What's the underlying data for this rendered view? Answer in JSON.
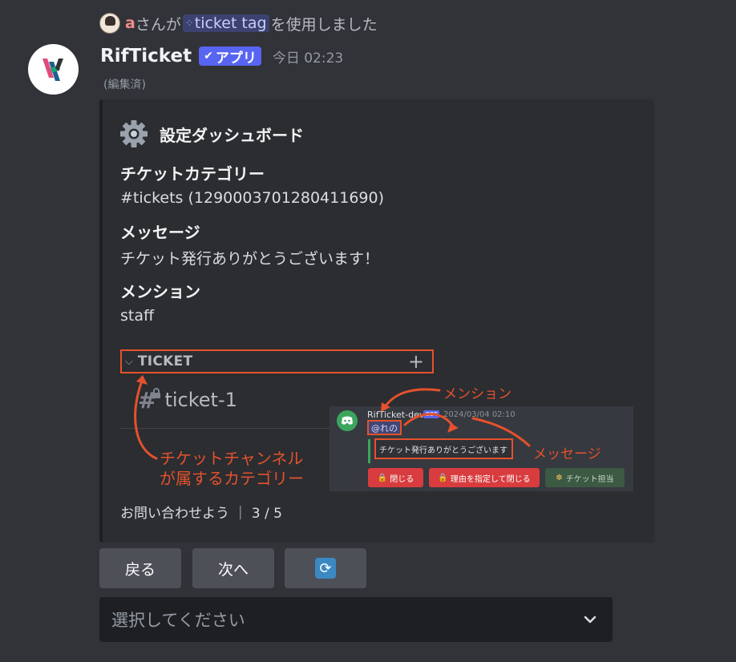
{
  "interaction": {
    "user": "a",
    "text_before": "さんが",
    "command": "ticket tag",
    "text_after": "を使用しました"
  },
  "message": {
    "bot_name": "RifTicket",
    "app_badge": "アプリ",
    "app_badge_check": "✔",
    "timestamp": "今日 02:23",
    "edited": "(編集済)"
  },
  "embed": {
    "title": "設定ダッシュボード",
    "fields": [
      {
        "name": "チケットカテゴリー",
        "value": "#tickets (1290003701280411690)"
      },
      {
        "name": "メッセージ",
        "value": "チケット発行ありがとうございます！"
      },
      {
        "name": "メンション",
        "value": "staff"
      }
    ],
    "image": {
      "category_label": "TICKET",
      "channel_hash": "#",
      "channel_name": "ticket-1",
      "annotation_category_line1": "チケットチャンネル",
      "annotation_category_line2": "が属するカテゴリー",
      "annotation_mention": "メンション",
      "annotation_message": "メッセージ",
      "mini_bot_name": "RifTicket-dev",
      "mini_bot_tag": "BOT",
      "mini_time": "2024/03/04 02:10",
      "mini_mention": "@れの",
      "mini_message": "チケット発行ありがとうございます",
      "mini_btn_close": "閉じる",
      "mini_btn_reason": "理由を指定して閉じる",
      "mini_btn_claim": "チケット担当"
    },
    "footer": "お問い合わせよう ｜ 3 / 5"
  },
  "buttons": {
    "back": "戻る",
    "next": "次へ",
    "refresh_icon": "refresh-icon"
  },
  "select": {
    "placeholder": "選択してください"
  },
  "colors": {
    "background": "#313338",
    "embed": "#2b2d31",
    "accent": "#5865f2",
    "annotation": "#e5512c",
    "button": "#4e5058"
  }
}
